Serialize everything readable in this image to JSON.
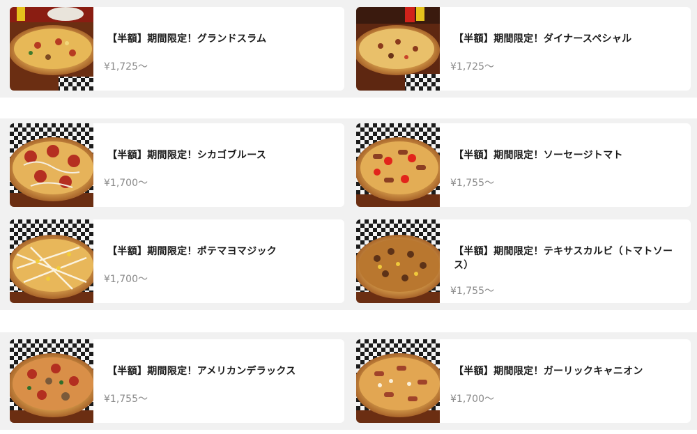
{
  "colors": {
    "background": "#f1f1f1",
    "card": "#ffffff",
    "title_text": "#1a1a1a",
    "price_text": "#8a8a8a"
  },
  "menu": {
    "items": [
      {
        "name": "【半額】期間限定！グランドスラム",
        "price": "¥1,725〜",
        "image": "pizza-grand-slam-image"
      },
      {
        "name": "【半額】期間限定！ダイナースペシャル",
        "price": "¥1,725〜",
        "image": "pizza-diner-special-image"
      },
      {
        "name": "【半額】期間限定！シカゴブルース",
        "price": "¥1,700〜",
        "image": "pizza-chicago-blues-image"
      },
      {
        "name": "【半額】期間限定！ソーセージトマト",
        "price": "¥1,755〜",
        "image": "pizza-sausage-tomato-image"
      },
      {
        "name": "【半額】期間限定！ポテマヨマジック",
        "price": "¥1,700〜",
        "image": "pizza-potemayo-magic-image"
      },
      {
        "name": "【半額】期間限定！テキサスカルビ（トマトソース）",
        "price": "¥1,755〜",
        "image": "pizza-texas-kalbi-image"
      },
      {
        "name": "【半額】期間限定！アメリカンデラックス",
        "price": "¥1,755〜",
        "image": "pizza-american-deluxe-image"
      },
      {
        "name": "【半額】期間限定！ガーリックキャニオン",
        "price": "¥1,700〜",
        "image": "pizza-garlic-canyon-image"
      }
    ]
  }
}
